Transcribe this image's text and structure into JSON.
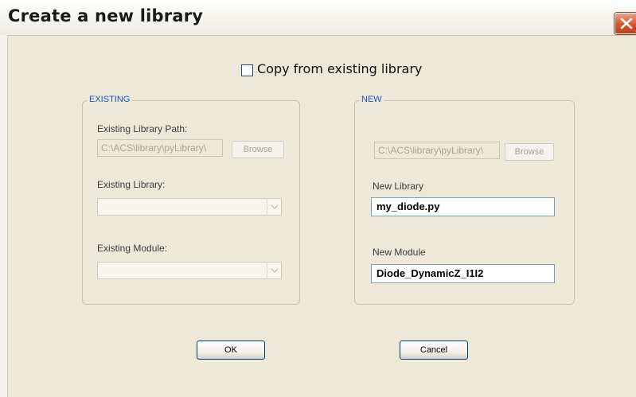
{
  "window": {
    "title": "Create a new library",
    "close_icon": "close-icon"
  },
  "copy_option": {
    "label": "Copy from existing library",
    "checked": false
  },
  "existing_group": {
    "legend": "EXISTING",
    "library_path_label": "Existing Library Path:",
    "library_path_value": "C:\\ACS\\library\\pyLibrary\\",
    "browse_label": "Browse",
    "library_label": "Existing Library:",
    "library_value": "",
    "module_label": "Existing Module:",
    "module_value": ""
  },
  "new_group": {
    "legend": "NEW",
    "library_path_value": "C:\\ACS\\library\\pyLibrary\\",
    "browse_label": "Browse",
    "library_label": "New Library",
    "library_value": "my_diode.py",
    "module_label": "New Module",
    "module_value": "Diode_DynamicZ_I1I2"
  },
  "buttons": {
    "ok_label": "OK",
    "cancel_label": "Cancel"
  },
  "colors": {
    "window_bg": "#ece9d8",
    "legend_text": "#1853c4",
    "close_button": "#d8532c"
  }
}
